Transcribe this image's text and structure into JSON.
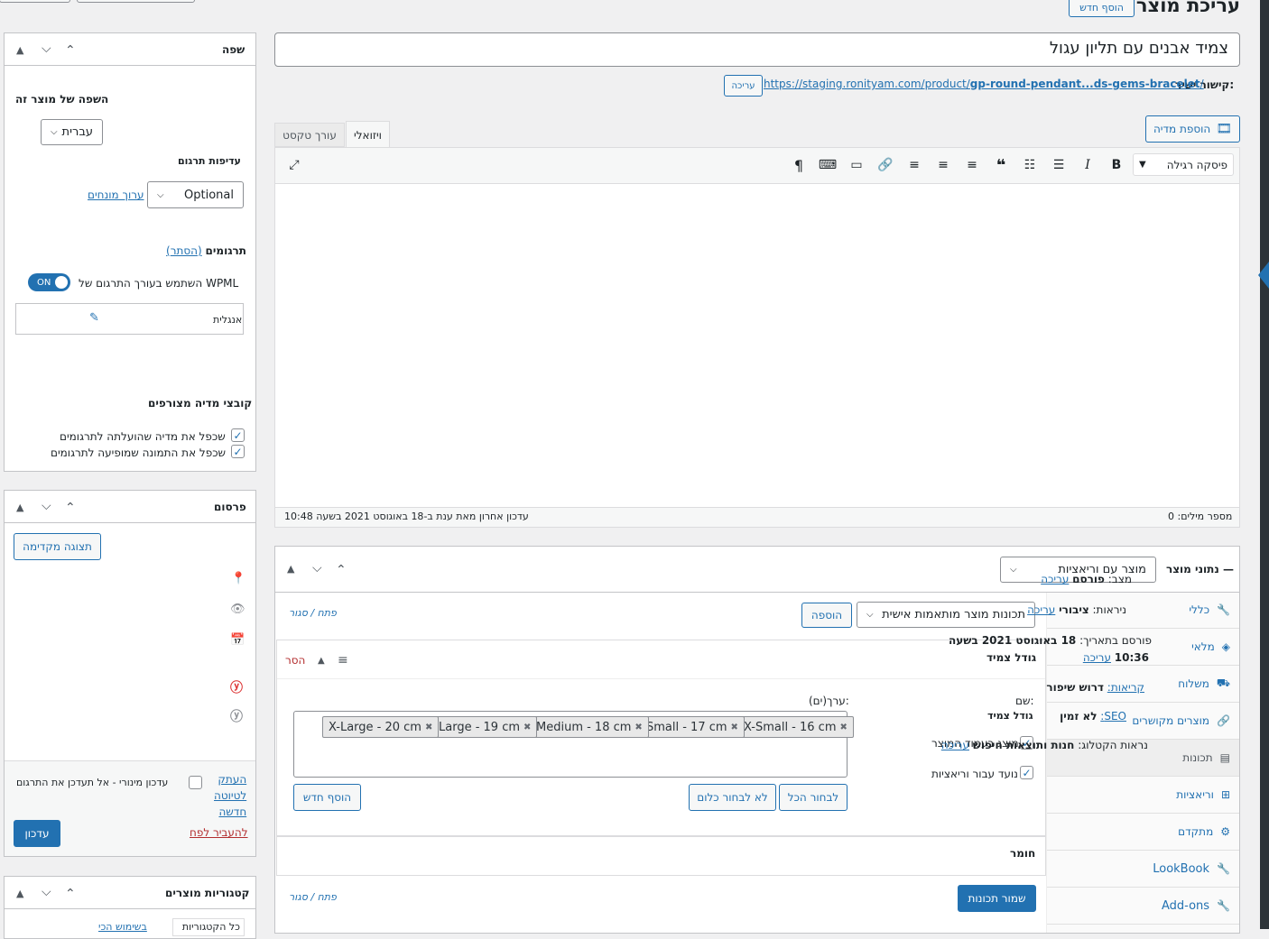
{
  "page": {
    "title": "עריכת מוצר",
    "add_new": "הוסף חדש"
  },
  "product": {
    "name": "צמיד אבנים עם תליון עגול",
    "permalink_label": "קישור ישיר:",
    "permalink_url": "https://staging.ronityam.com/product/",
    "permalink_slug": "gp-round-pendant...ds-gems-bracelet",
    "permalink_tail": "/",
    "permalink_edit": "עריכה"
  },
  "editor": {
    "add_media": "הוספת מדיה",
    "tab_visual": "ויזואלי",
    "tab_text": "עורך טקסט",
    "format_select": "פיסקה רגילה",
    "word_count": "מספר מילים: 0",
    "last_edit": "עדכון אחרון מאת ענת ב-18 באוגוסט 2021 בשעה 10:48"
  },
  "product_data": {
    "label": "נתוני מוצר —",
    "type_select": "מוצר עם וריאציות",
    "custom_attr_select": "תכונות מוצר מותאמות אישית",
    "add_btn": "הוספה",
    "open_close": "פתח / סגור",
    "attr1_title": "גודל צמיד",
    "remove": "הסר",
    "name_label": "שם:",
    "name_value": "גודל צמיד",
    "values_label": "ערך(ים):",
    "tags": [
      "X-Small - 16 cm",
      "Small - 17 cm",
      "Medium - 18 cm",
      "Large - 19 cm",
      "X-Large - 20 cm"
    ],
    "visible_label": "מוצג בעמוד המוצר",
    "variations_label": "נועד עבור וריאציות",
    "select_all": "לבחור הכל",
    "select_none": "לא לבחור כלום",
    "add_new": "הוסף חדש",
    "attr2_title": "חומר",
    "save_attrs": "שמור תכונות",
    "tabs": [
      {
        "label": "כללי",
        "icon": "wrench-icon"
      },
      {
        "label": "מלאי",
        "icon": "tag-icon"
      },
      {
        "label": "משלוח",
        "icon": "truck-icon"
      },
      {
        "label": "מוצרים מקושרים",
        "icon": "link-icon"
      },
      {
        "label": "תכונות",
        "icon": "list-icon"
      },
      {
        "label": "וריאציות",
        "icon": "grid-icon"
      },
      {
        "label": "מתקדם",
        "icon": "gear-icon"
      },
      {
        "label": "LookBook",
        "icon": "wrench-icon"
      },
      {
        "label": "Add-ons",
        "icon": "wrench-icon"
      }
    ]
  },
  "language_box": {
    "title": "שפה",
    "lang_of_product": "השפה של מוצר זה",
    "lang_select": "עברית",
    "priority_label": "עדיפות תרגום",
    "priority_select": "Optional",
    "term_editor": "ערוך מונחים",
    "translations": "תרגומים",
    "hide": "(הסתר)",
    "wpml_editor": "השתמש בעורך התרגום של WPML",
    "toggle": "ON",
    "english": "אנגלית",
    "media_title": "קובצי מדיה מצורפים",
    "dup_media": "שכפל את מדיה שהועלתה לתרגומים",
    "dup_image": "שכפל את התמונה שמופיעה לתרגומים"
  },
  "publish_box": {
    "title": "פרסום",
    "preview": "תצוגה מקדימה",
    "status_label": "מצב:",
    "status_value": "פורסם",
    "visibility_label": "ניראות:",
    "visibility_value": "ציבורי",
    "published_label": "פורסם בתאריך:",
    "published_value": "18 באוגוסט 2021 בשעה",
    "published_time": "10:36",
    "edit": "עריכה",
    "readability_label": "קריאות:",
    "readability_value": "דרוש שיפור",
    "seo_label": "SEO:",
    "seo_value": "לא זמין",
    "catalog_label": "נראות הקטלוג:",
    "catalog_value": "חנות ותוצאות חיפוש",
    "minor_update": "עדכון מינורי - אל תעדכן את התרגום",
    "copy_draft_1": "העתק",
    "copy_draft_2": "לטיוטה",
    "copy_draft_3": "חדשה",
    "trash": "להעביר לפח",
    "update": "עדכון"
  },
  "categories_box": {
    "title": "קטגוריות מוצרים",
    "all_cats": "כל הקטגוריות",
    "most_used": "בשימוש הכי"
  }
}
